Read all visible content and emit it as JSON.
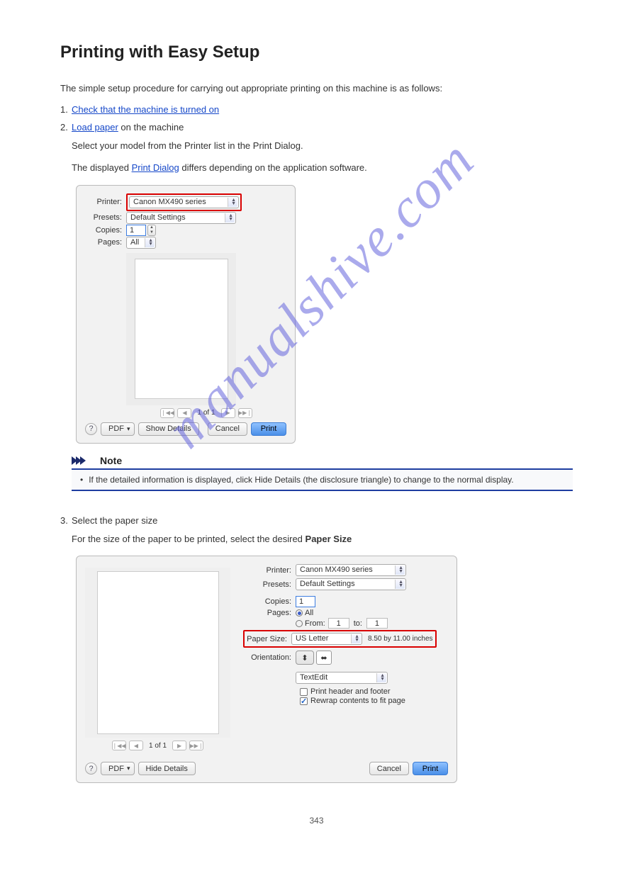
{
  "watermark": "manualshive.com",
  "heading": "Printing with Easy Setup",
  "intro": "The simple setup procedure for carrying out appropriate printing on this machine is as follows:",
  "steps": [
    {
      "num": "1.",
      "text": "Check that the machine is turned on"
    },
    {
      "num": "2.",
      "link": "Load paper",
      "tail": " on the machine",
      "detail": "Select your model from the Printer list in the Print Dialog.",
      "note_prefix": "The displayed ",
      "note_link": "Print Dialog",
      "note_suffix": " differs depending on the application software."
    },
    {
      "num": "3.",
      "text": "Select the paper size",
      "detail_prefix": "For the size of the paper to be printed, select the desired ",
      "detail_bold": "Paper Size"
    }
  ],
  "dialog1": {
    "printer_lbl": "Printer:",
    "printer": "Canon MX490 series",
    "presets_lbl": "Presets:",
    "presets": "Default Settings",
    "copies_lbl": "Copies:",
    "copies": "1",
    "pages_lbl": "Pages:",
    "pages": "All",
    "pager": "1 of 1",
    "pdf": "PDF",
    "show_details": "Show Details",
    "cancel": "Cancel",
    "print": "Print"
  },
  "note": {
    "label": "Note",
    "text": "If the detailed information is displayed, click Hide Details (the disclosure triangle) to change to the normal display."
  },
  "dialog2": {
    "printer_lbl": "Printer:",
    "printer": "Canon MX490 series",
    "presets_lbl": "Presets:",
    "presets": "Default Settings",
    "copies_lbl": "Copies:",
    "copies": "1",
    "pages_lbl": "Pages:",
    "all": "All",
    "from_lbl": "From:",
    "from_val": "1",
    "to_lbl": "to:",
    "to_val": "1",
    "paper_lbl": "Paper Size:",
    "paper": "US Letter",
    "paper_dim": "8.50 by 11.00 inches",
    "orient_lbl": "Orientation:",
    "app": "TextEdit",
    "header_footer": "Print header and footer",
    "rewrap": "Rewrap contents to fit page",
    "pager": "1 of 1",
    "pdf": "PDF",
    "hide_details": "Hide Details",
    "cancel": "Cancel",
    "print": "Print"
  },
  "pagenum": "343"
}
